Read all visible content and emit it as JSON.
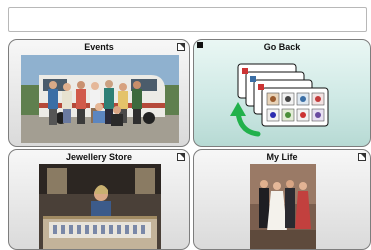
{
  "message_bar": {
    "text": ""
  },
  "tiles": [
    {
      "label": "Events",
      "kind": "folder",
      "icon": "photo-group-people-van"
    },
    {
      "label": "Go Back",
      "kind": "navigation",
      "icon": "back-arrow-grid-icon"
    },
    {
      "label": "Jewellery Store",
      "kind": "folder",
      "icon": "photo-jewellery-store"
    },
    {
      "label": "My Life",
      "kind": "folder",
      "icon": "photo-wedding"
    }
  ],
  "colors": {
    "back_tile": "#cfe9e5",
    "arrow": "#22b14c",
    "border": "#7d7d7d"
  }
}
